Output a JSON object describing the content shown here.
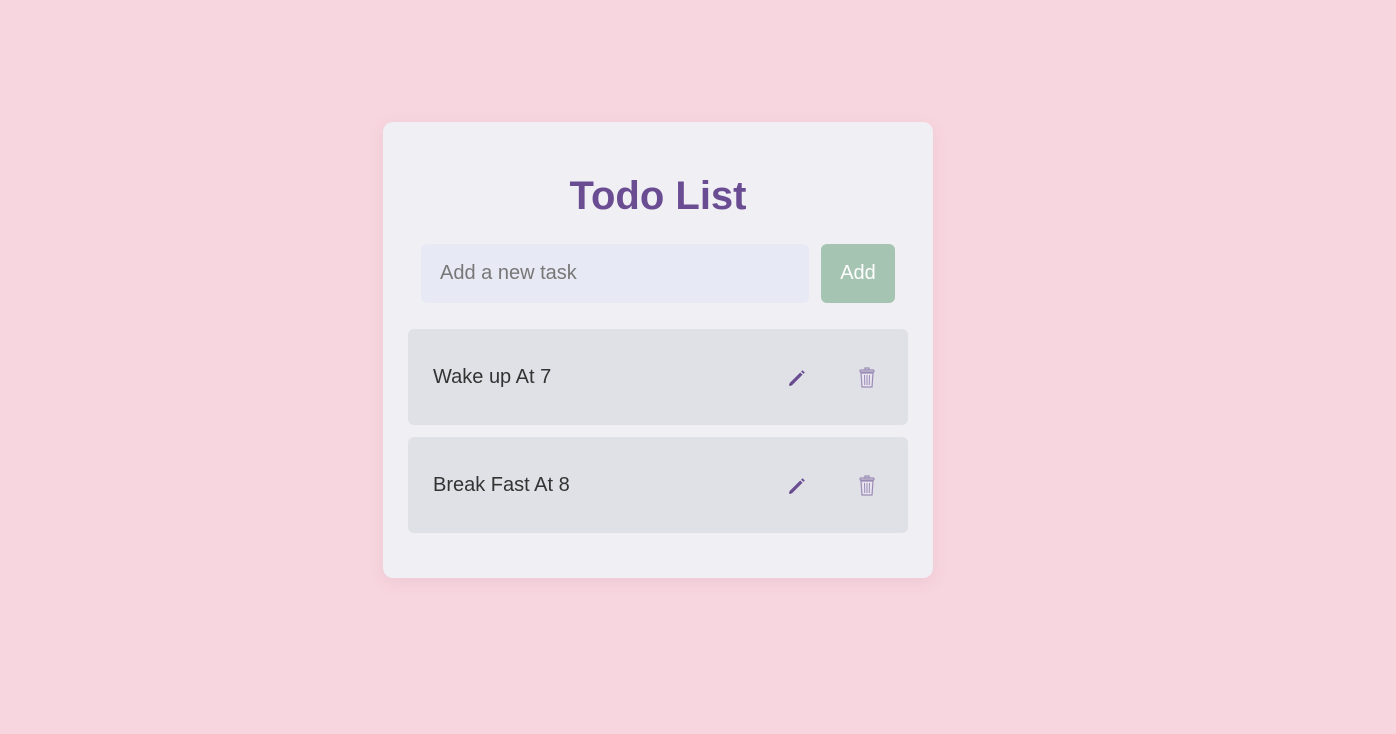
{
  "app": {
    "title": "Todo List"
  },
  "input": {
    "placeholder": "Add a new task",
    "value": ""
  },
  "add_button": {
    "label": "Add"
  },
  "tasks": [
    {
      "text": "Wake up At 7",
      "edit_icon": "pencil-icon",
      "delete_icon": "trash-icon"
    },
    {
      "text": "Break Fast At 8",
      "edit_icon": "pencil-icon",
      "delete_icon": "trash-icon"
    }
  ],
  "colors": {
    "page_background": "#f7d6df",
    "card_background": "#f0eff4",
    "title": "#6a4c93",
    "input_background": "#e7e9f4",
    "add_button": "#a5c4b1",
    "task_background": "#e0e1e6",
    "edit_icon": "#6a4c93",
    "delete_icon": "#9a8bb5"
  }
}
